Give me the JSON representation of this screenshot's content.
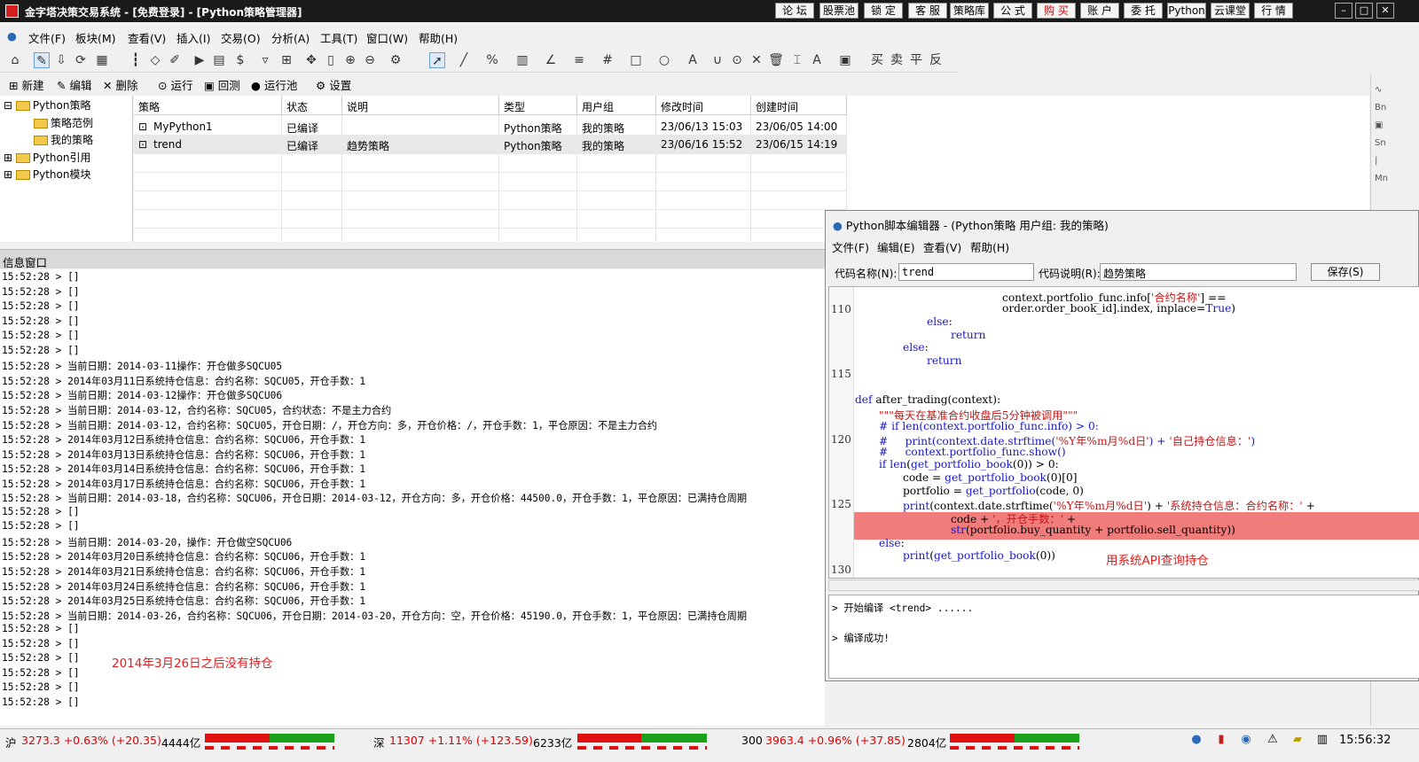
{
  "window": {
    "title": "金字塔决策交易系统 - [免费登录] - [Python策略管理器]",
    "top_buttons": [
      "论 坛",
      "股票池",
      "锁 定",
      "客 服",
      "策略库",
      "公 式",
      "购 买",
      "账 户",
      "委 托",
      "Python",
      "云课堂",
      "行 情"
    ],
    "controls": [
      "–",
      "□",
      "✕"
    ]
  },
  "menu": [
    "文件(F)",
    "板块(M)",
    "查看(V)",
    "插入(I)",
    "交易(O)",
    "分析(A)",
    "工具(T)",
    "窗口(W)",
    "帮助(H)"
  ],
  "toolbar2": {
    "new": "新建",
    "edit": "编辑",
    "delete": "删除",
    "run": "运行",
    "backtest": "回测",
    "runpool": "运行池",
    "settings": "设置"
  },
  "tree": {
    "items": [
      "Python策略",
      "策略范例",
      "我的策略",
      "Python引用",
      "Python模块"
    ]
  },
  "grid": {
    "columns": [
      "策略",
      "状态",
      "说明",
      "类型",
      "用户组",
      "修改时间",
      "创建时间"
    ],
    "rows": [
      [
        "MyPython1",
        "已编译",
        "",
        "Python策略",
        "我的策略",
        "23/06/13 15:03",
        "23/06/05 14:00"
      ],
      [
        "trend",
        "已编译",
        "趋势策略",
        "Python策略",
        "我的策略",
        "23/06/16 15:52",
        "23/06/15 14:19"
      ]
    ]
  },
  "right_bar": [
    "Bn",
    "Sn",
    "Mn"
  ],
  "info": {
    "title": "信息窗口",
    "lines": [
      "15:52:28 > []",
      "15:52:28 > []",
      "15:52:28 > []",
      "15:52:28 > []",
      "15:52:28 > []",
      "15:52:28 > []",
      "15:52:28 > 当前日期：2014-03-11操作：开仓做多SQCU05",
      "15:52:28 > 2014年03月11日系统持仓信息：合约名称：SQCU05，开仓手数：1",
      "15:52:28 > 当前日期：2014-03-12操作：开仓做多SQCU06",
      "15:52:28 > 当前日期：2014-03-12，合约名称：SQCU05，合约状态：不是主力合约",
      "15:52:28 > 当前日期：2014-03-12，合约名称：SQCU05，开仓日期：/，开仓方向：多，开仓价格：/，开仓手数：1，平仓原因：不是主力合约",
      "15:52:28 > 2014年03月12日系统持仓信息：合约名称：SQCU06，开仓手数：1",
      "15:52:28 > 2014年03月13日系统持仓信息：合约名称：SQCU06，开仓手数：1",
      "15:52:28 > 2014年03月14日系统持仓信息：合约名称：SQCU06，开仓手数：1",
      "15:52:28 > 2014年03月17日系统持仓信息：合约名称：SQCU06，开仓手数：1",
      "15:52:28 > 当前日期：2014-03-18，合约名称：SQCU06，开仓日期：2014-03-12，开仓方向：多，开仓价格：44500.0，开仓手数：1，平仓原因：已满持仓周期",
      "15:52:28 > []",
      "15:52:28 > []",
      "15:52:28 > 当前日期：2014-03-20，操作：开仓做空SQCU06",
      "15:52:28 > 2014年03月20日系统持仓信息：合约名称：SQCU06，开仓手数：1",
      "15:52:28 > 2014年03月21日系统持仓信息：合约名称：SQCU06，开仓手数：1",
      "15:52:28 > 2014年03月24日系统持仓信息：合约名称：SQCU06，开仓手数：1",
      "15:52:28 > 2014年03月25日系统持仓信息：合约名称：SQCU06，开仓手数：1",
      "15:52:28 > 当前日期：2014-03-26，合约名称：SQCU06，开仓日期：2014-03-20，开仓方向：空，开仓价格：45190.0，开仓手数：1，平仓原因：已满持仓周期",
      "15:52:28 > []",
      "15:52:28 > []",
      "15:52:28 > []",
      "15:52:28 > []",
      "15:52:28 > []",
      "15:52:28 > []"
    ],
    "annotation": "2014年3月26日之后没有持仓"
  },
  "editor": {
    "title": "Python脚本编辑器 - (Python策略 用户组: 我的策略)",
    "menu": [
      "文件(F)",
      "编辑(E)",
      "查看(V)",
      "帮助(H)"
    ],
    "code_name_label": "代码名称(N):",
    "code_name": "trend",
    "code_desc_label": "代码说明(R):",
    "code_desc": "趋势策略",
    "save_label": "保存(S)",
    "line_numbers": [
      "110",
      "115",
      "120",
      "125",
      "130"
    ],
    "annotation": "用系统API查询持仓",
    "output": [
      "> 开始编译 <trend> ......",
      "> 编译成功!"
    ]
  },
  "status": {
    "sh_label": "沪",
    "sh_value": "3273.3 +0.63% (+20.35)",
    "sh_vol": "4444亿",
    "sz_label": "深",
    "sz_value": "11307 +1.11% (+123.59)",
    "sz_vol": "6233亿",
    "h300_label": "300",
    "h300_value": "3963.4 +0.96% (+37.85)",
    "h300_vol": "2804亿",
    "clock": "15:56:32"
  },
  "colors": {
    "up": "#e00000",
    "down": "#1aa01a",
    "highlight": "#f07c7c",
    "annotation": "#e02020"
  }
}
